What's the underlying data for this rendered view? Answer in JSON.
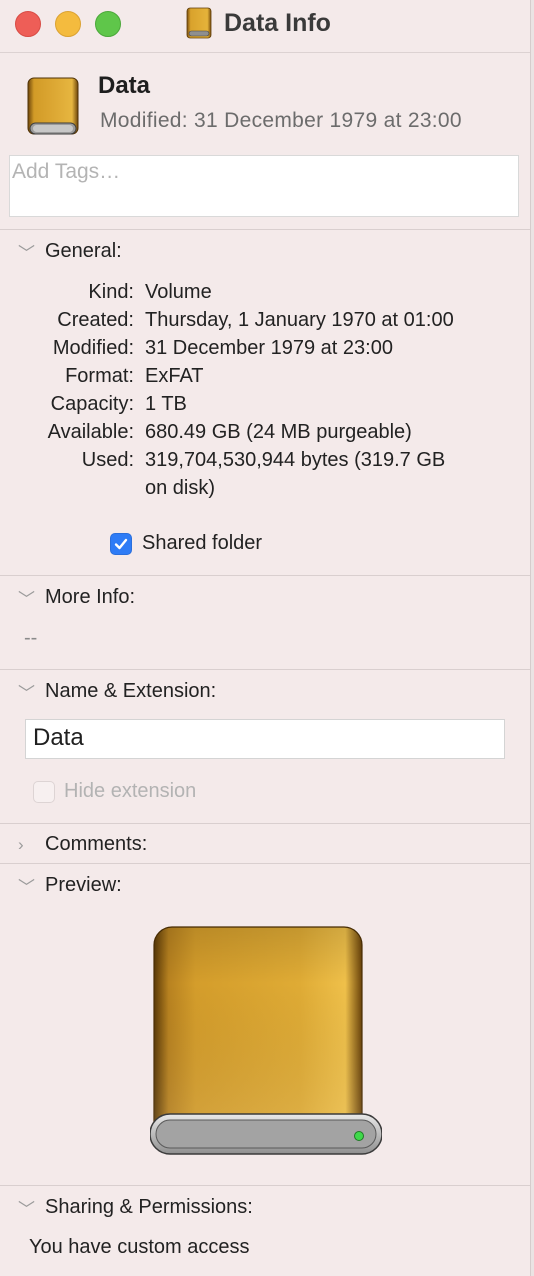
{
  "window": {
    "title": "Data Info"
  },
  "header": {
    "name": "Data",
    "modified": "Modified:  31 December 1979 at 23:00"
  },
  "tags": {
    "placeholder": "Add Tags…"
  },
  "general": {
    "title": "General:",
    "rows": [
      {
        "label": "Kind:",
        "value": "Volume"
      },
      {
        "label": "Created:",
        "value": "Thursday, 1 January 1970 at 01:00"
      },
      {
        "label": "Modified:",
        "value": "31 December 1979 at 23:00"
      },
      {
        "label": "Format:",
        "value": "ExFAT"
      },
      {
        "label": "Capacity:",
        "value": "1 TB"
      },
      {
        "label": "Available:",
        "value": "680.49 GB (24 MB purgeable)"
      },
      {
        "label": "Used:",
        "value": "319,704,530,944 bytes (319.7 GB",
        "value2": "on disk)"
      }
    ],
    "shared_folder": {
      "label": "Shared folder",
      "checked": true
    }
  },
  "more_info": {
    "title": "More Info:",
    "value": "--"
  },
  "name_ext": {
    "title": "Name & Extension:",
    "value": "Data",
    "hide_extension": {
      "label": "Hide extension",
      "checked": false
    }
  },
  "comments": {
    "title": "Comments:"
  },
  "preview": {
    "title": "Preview:"
  },
  "sharing": {
    "title": "Sharing & Permissions:",
    "access": "You have custom access"
  },
  "colors": {
    "accent": "#2e7cf6",
    "drive_gold": "#d9a22c",
    "background": "#f4eaea"
  }
}
